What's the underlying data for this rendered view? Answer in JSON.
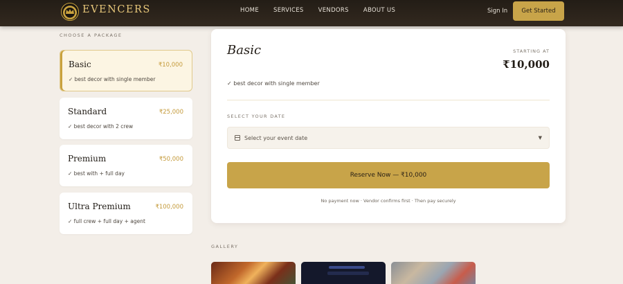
{
  "nav": {
    "brand": "EVENCERS",
    "links": [
      "HOME",
      "SERVICES",
      "VENDORS",
      "ABOUT US"
    ],
    "sign_in": "Sign In",
    "get_started": "Get Started"
  },
  "packages": {
    "heading": "CHOOSE A PACKAGE",
    "items": [
      {
        "name": "Basic",
        "price": "₹10,000",
        "desc": "✓ best decor with single member",
        "selected": true
      },
      {
        "name": "Standard",
        "price": "₹25,000",
        "desc": "✓ best decor with 2 crew",
        "selected": false
      },
      {
        "name": "Premium",
        "price": "₹50,000",
        "desc": "✓ best with + full day",
        "selected": false
      },
      {
        "name": "Ultra Premium",
        "price": "₹100,000",
        "desc": "✓ full crew + full day + agent",
        "selected": false
      }
    ]
  },
  "detail": {
    "title": "Basic",
    "starting_label": "STARTING AT",
    "price": "₹10,000",
    "desc": "✓ best decor with single member",
    "date_label": "SELECT YOUR DATE",
    "date_placeholder": "Select your event date",
    "reserve_label": "Reserve Now — ₹10,000",
    "note": "No payment now · Vendor confirms first · Then pay securely"
  },
  "gallery": {
    "heading": "GALLERY"
  },
  "colors": {
    "accent": "#c8a449",
    "nav_bg": "#2a231b",
    "page_bg": "#f3eee8"
  }
}
